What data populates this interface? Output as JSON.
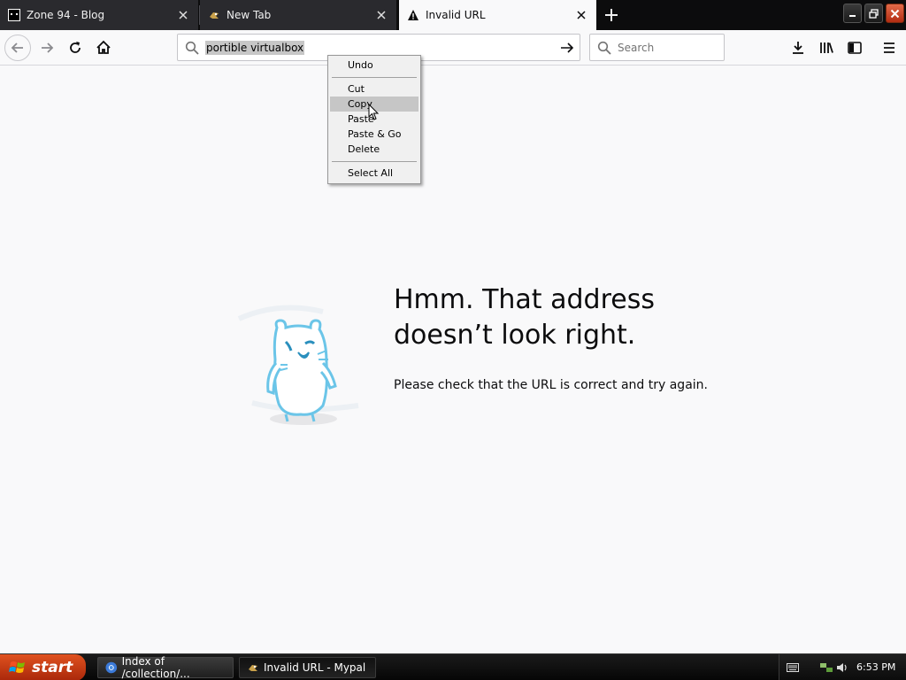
{
  "tabs": [
    {
      "label": "Zone 94 - Blog",
      "favicon": "zone94-icon",
      "active": false
    },
    {
      "label": "New Tab",
      "favicon": "mypal-icon",
      "active": false
    },
    {
      "label": "Invalid URL",
      "favicon": "warning-icon",
      "active": true
    }
  ],
  "navbar": {
    "url_value": "portible virtualbox",
    "search_placeholder": "Search"
  },
  "context_menu": {
    "items": [
      {
        "label": "Undo",
        "highlighted": false
      },
      {
        "label": "Cut",
        "highlighted": false
      },
      {
        "label": "Copy",
        "highlighted": true
      },
      {
        "label": "Paste",
        "highlighted": false
      },
      {
        "label": "Paste & Go",
        "highlighted": false
      },
      {
        "label": "Delete",
        "highlighted": false
      },
      {
        "label": "Select All",
        "highlighted": false
      }
    ]
  },
  "error_page": {
    "title": "Hmm. That address doesn’t look right.",
    "description": "Please check that the URL is correct and try again."
  },
  "taskbar": {
    "start_label": "start",
    "tasks": [
      {
        "label": "Index of /collection/...",
        "icon": "chrome-icon"
      },
      {
        "label": "Invalid URL - Mypal",
        "icon": "mypal-icon"
      }
    ],
    "clock": "6:53 PM"
  },
  "colors": {
    "tab_strip_bg": "#0c0c0d",
    "active_tab_bg": "#f9f9fa",
    "start_button": "#c33d12",
    "close_button": "#d2491f",
    "mascot": "#6bc5e8"
  }
}
